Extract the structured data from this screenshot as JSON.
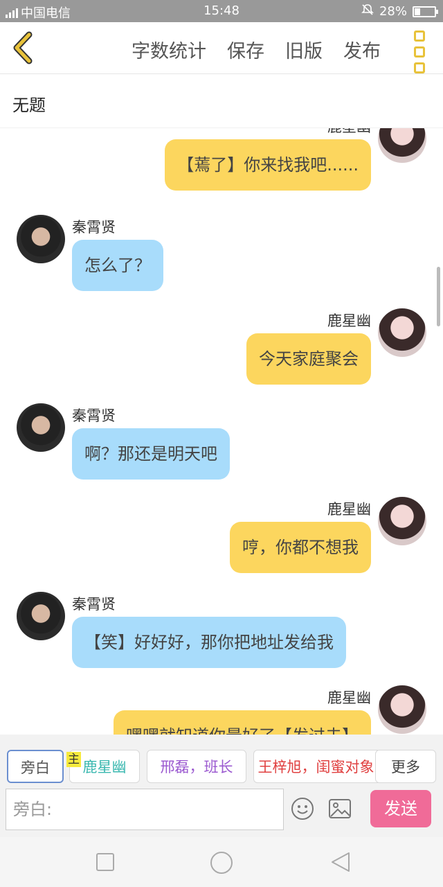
{
  "status": {
    "carrier": "中国电信",
    "time": "15:48",
    "battery": "28%",
    "battery_level": 0.28
  },
  "toolbar": {
    "word_count": "字数统计",
    "save": "保存",
    "old_version": "旧版",
    "publish": "发布"
  },
  "title": "无题",
  "messages": [
    {
      "side": "right",
      "name": "鹿星幽",
      "text": "【蔫了】你来找我吧......",
      "color": "#fcd65e"
    },
    {
      "side": "left",
      "name": "秦霄贤",
      "text": "怎么了？",
      "color": "#a8dcfb"
    },
    {
      "side": "right",
      "name": "鹿星幽",
      "text": "今天家庭聚会",
      "color": "#fcd65e"
    },
    {
      "side": "left",
      "name": "秦霄贤",
      "text": "啊？那还是明天吧",
      "color": "#a8dcfb"
    },
    {
      "side": "right",
      "name": "鹿星幽",
      "text": "哼，你都不想我",
      "color": "#fcd65e"
    },
    {
      "side": "left",
      "name": "秦霄贤",
      "text": "【笑】好好好，那你把地址发给我",
      "color": "#a8dcfb"
    },
    {
      "side": "right",
      "name": "鹿星幽",
      "text": "嘿嘿就知道你最好了【发过去】",
      "color": "#fcd65e"
    }
  ],
  "roles": [
    {
      "label": "旁白",
      "color": "#555555"
    },
    {
      "label": "鹿星幽",
      "color": "#3bb8b0"
    },
    {
      "label": "邢磊，班长",
      "color": "#9b59d0"
    },
    {
      "label": "王梓旭，闺蜜对象",
      "color": "#e04040"
    }
  ],
  "main_badge": "主",
  "more": "更多",
  "input_placeholder": "旁白:",
  "send": "发送"
}
